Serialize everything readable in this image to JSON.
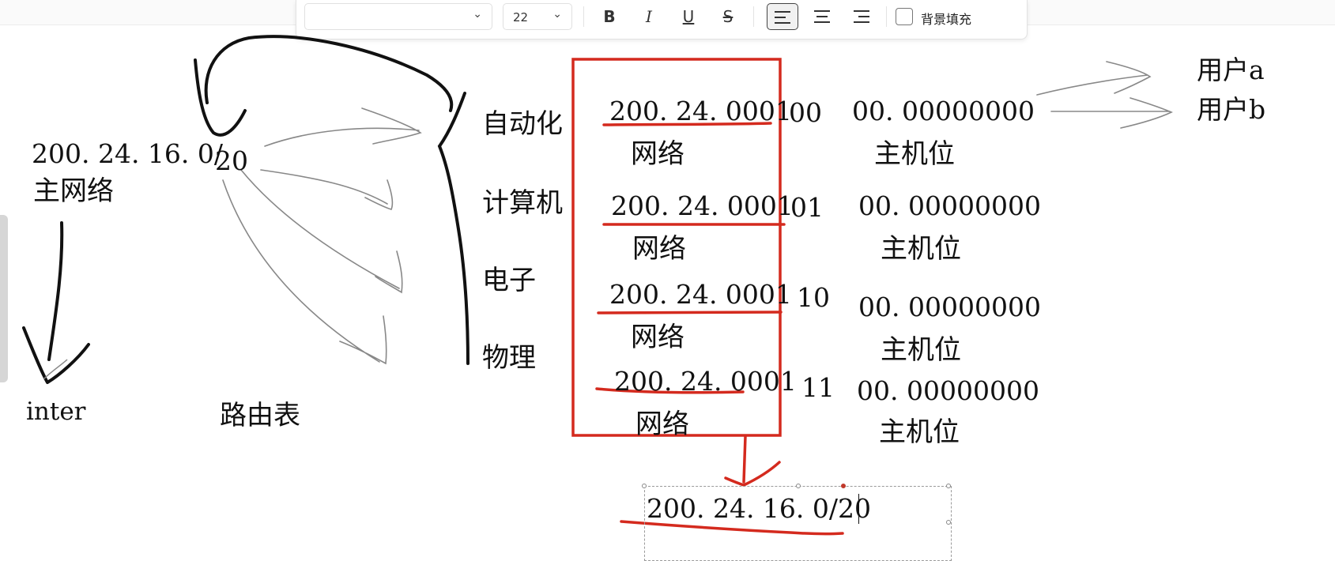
{
  "toolbar": {
    "font_family_value": "",
    "font_size": "22",
    "bold_label": "B",
    "italic_label": "I",
    "underline_label": "U",
    "strike_label": "S",
    "bg_fill_label": "背景填充",
    "bg_fill_checked": false,
    "active_align": "left"
  },
  "colors": {
    "ink": "#111111",
    "red_ink": "#d42a1e",
    "pencil": "#8a8a8a"
  },
  "canvas": {
    "left": {
      "main_ip": "200. 24. 16. 0/",
      "prefix_len": "20",
      "main_network_label": "主网络",
      "inter_label": "inter",
      "routing_table_label": "路由表"
    },
    "departments": [
      "自动化",
      "计算机",
      "电子",
      "物理"
    ],
    "subnets": [
      {
        "network": "200. 24. 0001",
        "bits": "00",
        "host": "00. 00000000",
        "net_label": "网络",
        "host_label": "主机位"
      },
      {
        "network": "200. 24. 0001",
        "bits": "01",
        "host": "00. 00000000",
        "net_label": "网络",
        "host_label": "主机位"
      },
      {
        "network": "200. 24. 0001",
        "bits": "10",
        "host": "00. 00000000",
        "net_label": "网络",
        "host_label": "主机位"
      },
      {
        "network": "200. 24. 0001",
        "bits": "11",
        "host": "00. 00000000",
        "net_label": "网络",
        "host_label": "主机位"
      }
    ],
    "users": [
      "用户a",
      "用户b"
    ],
    "selected_text": "200. 24. 16. 0/20"
  }
}
